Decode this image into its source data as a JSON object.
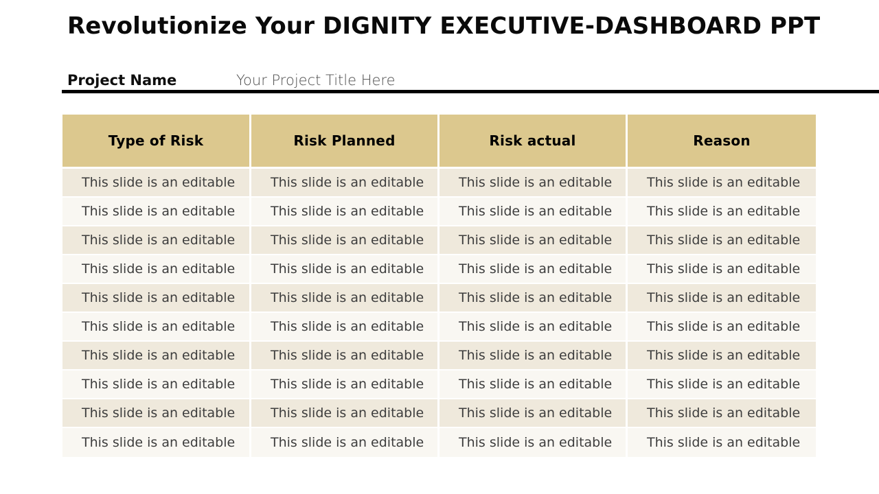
{
  "slide": {
    "title": "Revolutionize Your DIGNITY EXECUTIVE-DASHBOARD PPT",
    "background_color": "#FFFFFF"
  },
  "project": {
    "label": "Project Name",
    "value": "Your Project Title Here",
    "rule_color": "#000000"
  },
  "table": {
    "header_background": "#DCC88E",
    "header_text_color": "#000000",
    "row_odd_background": "#EFE9DC",
    "row_even_background": "#F9F7F2",
    "body_text_color": "#3D3D3D",
    "columns": [
      "Type of Risk",
      "Risk Planned",
      "Risk actual",
      "Reason"
    ],
    "rows": [
      [
        "This slide is an editable",
        "This slide is an editable",
        "This slide is an editable",
        "This slide is an editable"
      ],
      [
        "This slide is an editable",
        "This slide is an editable",
        "This slide is an editable",
        "This slide is an editable"
      ],
      [
        "This slide is an editable",
        "This slide is an editable",
        "This slide is an editable",
        "This slide is an editable"
      ],
      [
        "This slide is an editable",
        "This slide is an editable",
        "This slide is an editable",
        "This slide is an editable"
      ],
      [
        "This slide is an editable",
        "This slide is an editable",
        "This slide is an editable",
        "This slide is an editable"
      ],
      [
        "This slide is an editable",
        "This slide is an editable",
        "This slide is an editable",
        "This slide is an editable"
      ],
      [
        "This slide is an editable",
        "This slide is an editable",
        "This slide is an editable",
        "This slide is an editable"
      ],
      [
        "This slide is an editable",
        "This slide is an editable",
        "This slide is an editable",
        "This slide is an editable"
      ],
      [
        "This slide is an editable",
        "This slide is an editable",
        "This slide is an editable",
        "This slide is an editable"
      ],
      [
        "This slide is an editable",
        "This slide is an editable",
        "This slide is an editable",
        "This slide is an editable"
      ]
    ]
  }
}
